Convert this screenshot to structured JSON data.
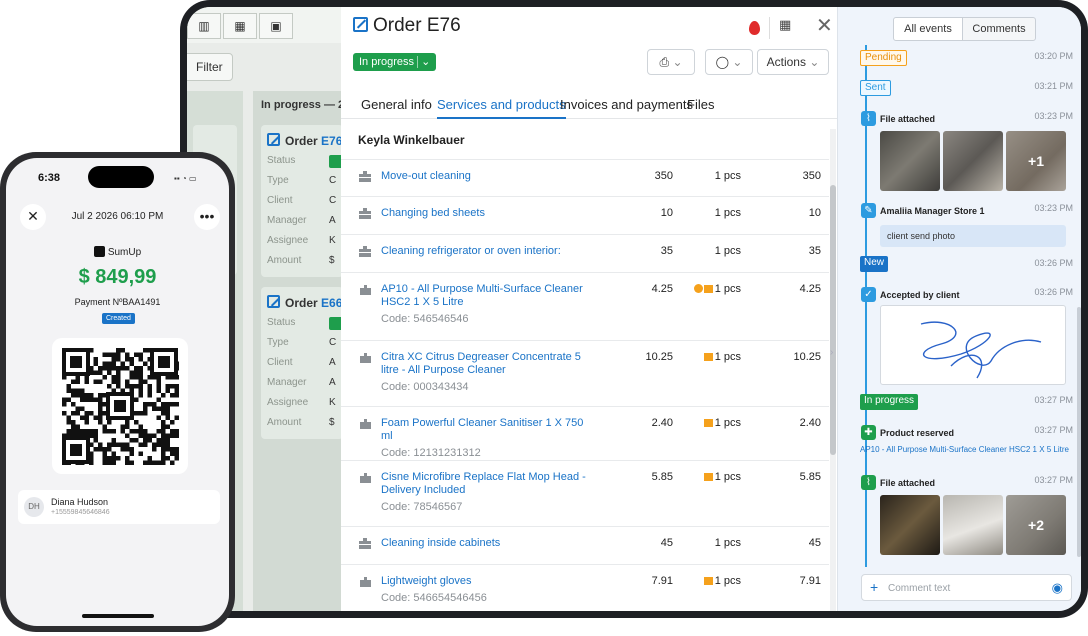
{
  "board": {
    "filter_label": "Filter",
    "column_header": "In progress — 2",
    "cards": [
      {
        "prefix": "Order",
        "id": "E76"
      },
      {
        "prefix": "Order",
        "id": "E66"
      }
    ],
    "field_labels": [
      "Status",
      "Type",
      "Client",
      "Manager",
      "Assignee",
      "Amount"
    ],
    "card1_initials": [
      "C",
      "C",
      "A",
      "K",
      "$"
    ],
    "card2_initials": [
      "C",
      "A",
      "A",
      "K",
      "$"
    ]
  },
  "order": {
    "title": "Order E76",
    "status": "In progress",
    "actions_label": "Actions",
    "tabs": [
      "General info",
      "Services and products",
      "Invoices and payments",
      "Files"
    ],
    "active_tab": 1,
    "client": "Keyla Winkelbauer",
    "items": [
      {
        "kind": "service",
        "name": "Move-out cleaning",
        "code": "",
        "price": "350",
        "qty": "1 pcs",
        "total": "350",
        "badge": ""
      },
      {
        "kind": "service",
        "name": "Changing bed sheets",
        "code": "",
        "price": "10",
        "qty": "1 pcs",
        "total": "10",
        "badge": ""
      },
      {
        "kind": "service",
        "name": "Cleaning refrigerator or oven interior:",
        "code": "",
        "price": "35",
        "qty": "1 pcs",
        "total": "35",
        "badge": ""
      },
      {
        "kind": "product",
        "name": "AP10 - All Purpose Multi-Surface Cleaner HSC2 1 X 5 Litre",
        "code": "Code: 546546546",
        "price": "4.25",
        "qty": "1 pcs",
        "total": "4.25",
        "badge": "both"
      },
      {
        "kind": "product",
        "name": "Citra XC Citrus Degreaser Concentrate 5 litre - All Purpose Cleaner",
        "code": "Code: 000343434",
        "price": "10.25",
        "qty": "1 pcs",
        "total": "10.25",
        "badge": "box"
      },
      {
        "kind": "product",
        "name": "Foam Powerful Cleaner Sanitiser 1 X 750 ml",
        "code": "Code: 12131231312",
        "price": "2.40",
        "qty": "1 pcs",
        "total": "2.40",
        "badge": "box"
      },
      {
        "kind": "product",
        "name": "Cisne Microfibre Replace Flat Mop Head - Delivery Included",
        "code": "Code: 78546567",
        "price": "5.85",
        "qty": "1 pcs",
        "total": "5.85",
        "badge": "box"
      },
      {
        "kind": "service",
        "name": "Cleaning inside cabinets",
        "code": "",
        "price": "45",
        "qty": "1 pcs",
        "total": "45",
        "badge": ""
      },
      {
        "kind": "product",
        "name": "Lightweight gloves",
        "code": "Code: 546654546456",
        "price": "7.91",
        "qty": "1 pcs",
        "total": "7.91",
        "badge": "box"
      }
    ]
  },
  "events": {
    "tabs": [
      "All events",
      "Comments"
    ],
    "pending": {
      "label": "Pending",
      "time": "03:20 PM"
    },
    "sent": {
      "label": "Sent",
      "time": "03:21 PM"
    },
    "file1": {
      "title": "File attached",
      "time": "03:23 PM",
      "more": "+1"
    },
    "comment": {
      "author": "Amaliia Manager Store 1",
      "time": "03:23 PM",
      "text": "client send photo"
    },
    "new": {
      "label": "New",
      "time": "03:26 PM"
    },
    "accepted": {
      "title": "Accepted by client",
      "time": "03:26 PM"
    },
    "inprogress": {
      "label": "In progress",
      "time": "03:27 PM"
    },
    "reserved": {
      "title": "Product reserved",
      "time": "03:27 PM",
      "product": "AP10 - All Purpose Multi-Surface Cleaner HSC2 1 X 5 Litre"
    },
    "file2": {
      "title": "File attached",
      "time": "03:27 PM",
      "more": "+2"
    },
    "comment_placeholder": "Comment text"
  },
  "phone": {
    "time": "6:38",
    "date": "Jul 2 2026 06:10 PM",
    "brand": "SumUp",
    "amount": "$ 849,99",
    "payment": "Payment NºBAA1491",
    "badge": "Created",
    "contact_initials": "DH",
    "contact_name": "Diana Hudson",
    "contact_phone": "+15559845646846"
  },
  "colors": {
    "accent": "#1a73c7",
    "status_green": "#1e9e4c",
    "amount_green": "#1e9e4c",
    "timeline": "#2d9be0",
    "pending": "#f5a11c"
  }
}
